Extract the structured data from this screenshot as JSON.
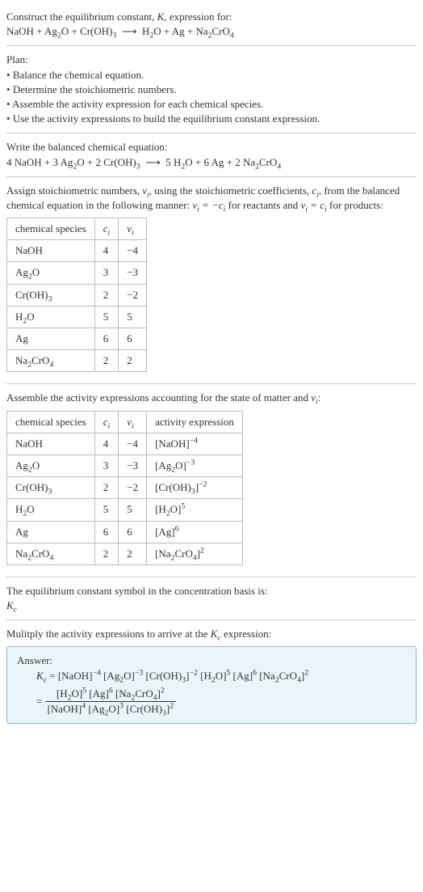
{
  "intro": {
    "line1_a": "Construct the equilibrium constant, ",
    "line1_b": ", expression for:",
    "eq_unbalanced": "NaOH + Ag₂O + Cr(OH)₃  ⟶  H₂O + Ag + Na₂CrO₄"
  },
  "plan": {
    "heading": "Plan:",
    "items": [
      "Balance the chemical equation.",
      "Determine the stoichiometric numbers.",
      "Assemble the activity expression for each chemical species.",
      "Use the activity expressions to build the equilibrium constant expression."
    ]
  },
  "balanced": {
    "heading": "Write the balanced chemical equation:",
    "eq": "4 NaOH + 3 Ag₂O + 2 Cr(OH)₃  ⟶  5 H₂O + 6 Ag + 2 Na₂CrO₄"
  },
  "assign": {
    "text_a": "Assign stoichiometric numbers, ",
    "text_b": ", using the stoichiometric coefficients, ",
    "text_c": ", from the balanced chemical equation in the following manner: ",
    "text_d": " for reactants and ",
    "text_e": " for products:",
    "nu": "νᵢ",
    "ci": "cᵢ",
    "rel_react": "νᵢ = −cᵢ",
    "rel_prod": "νᵢ = cᵢ",
    "headers": [
      "chemical species",
      "cᵢ",
      "νᵢ"
    ],
    "rows": [
      [
        "NaOH",
        "4",
        "−4"
      ],
      [
        "Ag₂O",
        "3",
        "−3"
      ],
      [
        "Cr(OH)₃",
        "2",
        "−2"
      ],
      [
        "H₂O",
        "5",
        "5"
      ],
      [
        "Ag",
        "6",
        "6"
      ],
      [
        "Na₂CrO₄",
        "2",
        "2"
      ]
    ]
  },
  "assemble": {
    "heading_a": "Assemble the activity expressions accounting for the state of matter and ",
    "heading_b": ":",
    "nu": "νᵢ",
    "headers": [
      "chemical species",
      "cᵢ",
      "νᵢ",
      "activity expression"
    ],
    "rows": [
      {
        "sp": "NaOH",
        "c": "4",
        "v": "−4",
        "ae_base": "[NaOH]",
        "ae_exp": "−4"
      },
      {
        "sp": "Ag₂O",
        "c": "3",
        "v": "−3",
        "ae_base": "[Ag₂O]",
        "ae_exp": "−3"
      },
      {
        "sp": "Cr(OH)₃",
        "c": "2",
        "v": "−2",
        "ae_base": "[Cr(OH)₃]",
        "ae_exp": "−2"
      },
      {
        "sp": "H₂O",
        "c": "5",
        "v": "5",
        "ae_base": "[H₂O]",
        "ae_exp": "5"
      },
      {
        "sp": "Ag",
        "c": "6",
        "v": "6",
        "ae_base": "[Ag]",
        "ae_exp": "6"
      },
      {
        "sp": "Na₂CrO₄",
        "c": "2",
        "v": "2",
        "ae_base": "[Na₂CrO₄]",
        "ae_exp": "2"
      }
    ]
  },
  "kc_symbol": {
    "line1": "The equilibrium constant symbol in the concentration basis is:",
    "symbol": "K_c"
  },
  "multiply": {
    "heading_a": "Mulitply the activity expressions to arrive at the ",
    "heading_b": " expression:",
    "kc": "K_c"
  },
  "answer": {
    "label": "Answer:",
    "kc": "K_c",
    "flat": " = [NaOH]⁻⁴ [Ag₂O]⁻³ [Cr(OH)₃]⁻² [H₂O]⁵ [Ag]⁶ [Na₂CrO₄]²",
    "eq_sign": " = ",
    "num": "[H₂O]⁵ [Ag]⁶ [Na₂CrO₄]²",
    "den": "[NaOH]⁴ [Ag₂O]³ [Cr(OH)₃]²"
  },
  "chart_data": {
    "type": "table",
    "tables": [
      {
        "title": "Stoichiometric numbers",
        "columns": [
          "chemical species",
          "c_i",
          "ν_i"
        ],
        "rows": [
          [
            "NaOH",
            4,
            -4
          ],
          [
            "Ag2O",
            3,
            -3
          ],
          [
            "Cr(OH)3",
            2,
            -2
          ],
          [
            "H2O",
            5,
            5
          ],
          [
            "Ag",
            6,
            6
          ],
          [
            "Na2CrO4",
            2,
            2
          ]
        ]
      },
      {
        "title": "Activity expressions",
        "columns": [
          "chemical species",
          "c_i",
          "ν_i",
          "activity expression"
        ],
        "rows": [
          [
            "NaOH",
            4,
            -4,
            "[NaOH]^-4"
          ],
          [
            "Ag2O",
            3,
            -3,
            "[Ag2O]^-3"
          ],
          [
            "Cr(OH)3",
            2,
            -2,
            "[Cr(OH)3]^-2"
          ],
          [
            "H2O",
            5,
            5,
            "[H2O]^5"
          ],
          [
            "Ag",
            6,
            6,
            "[Ag]^6"
          ],
          [
            "Na2CrO4",
            2,
            2,
            "[Na2CrO4]^2"
          ]
        ]
      }
    ]
  }
}
